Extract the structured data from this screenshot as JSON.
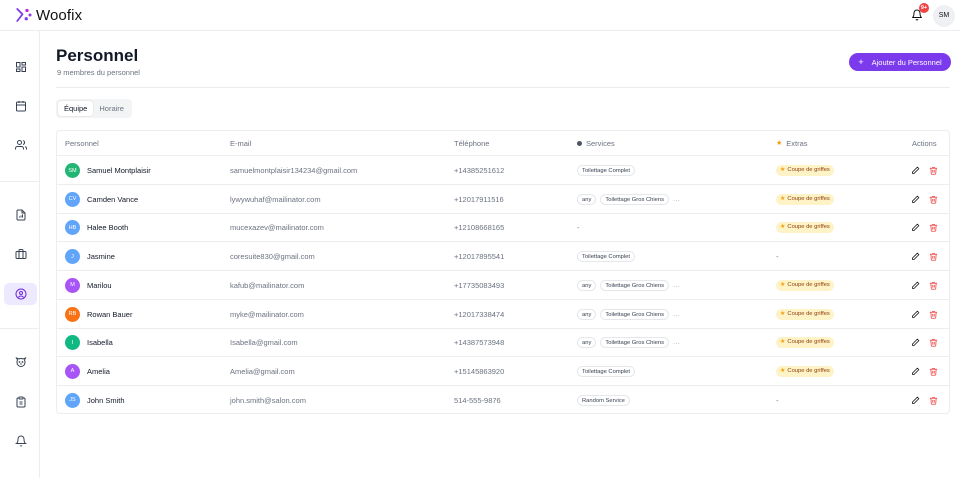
{
  "app": {
    "name": "Woofix"
  },
  "topbar": {
    "notification_count": "9+",
    "user_initials": "SM"
  },
  "sidebar": {
    "items": [
      {
        "name": "dashboard-icon"
      },
      {
        "name": "calendar-icon"
      },
      {
        "name": "users-icon"
      },
      {
        "name": "document-icon"
      },
      {
        "name": "briefcase-icon"
      },
      {
        "name": "user-circle-icon",
        "active": true
      },
      {
        "name": "dog-icon"
      },
      {
        "name": "clipboard-icon"
      },
      {
        "name": "bell-icon"
      }
    ]
  },
  "page": {
    "title": "Personnel",
    "subtitle": "9 membres du personnel",
    "add_button": "Ajouter du Personnel",
    "tabs": [
      {
        "label": "Équipe",
        "active": true
      },
      {
        "label": "Horaire",
        "active": false
      }
    ]
  },
  "table": {
    "headers": {
      "personnel": "Personnel",
      "email": "E-mail",
      "phone": "Téléphone",
      "services": "Services",
      "extras": "Extras",
      "actions": "Actions"
    },
    "rows": [
      {
        "initials": "SM",
        "color": "#22b573",
        "name": "Samuel Montplaisir",
        "email": "samuelmontplaisir134234@gmail.com",
        "phone": "+14385251612",
        "services": [
          "Toilettage Complet"
        ],
        "more": false,
        "extras": "Coupe de griffes"
      },
      {
        "initials": "CV",
        "color": "#60a5fa",
        "name": "Camden Vance",
        "email": "lywywuhaf@mailinator.com",
        "phone": "+12017911516",
        "services": [
          "any",
          "Toilettage Gros Chiens"
        ],
        "more": true,
        "extras": "Coupe de griffes"
      },
      {
        "initials": "HB",
        "color": "#60a5fa",
        "name": "Halee Booth",
        "email": "mucexazev@mailinator.com",
        "phone": "+12108668165",
        "services": [],
        "services_empty": "-",
        "more": false,
        "extras": "Coupe de griffes"
      },
      {
        "initials": "J",
        "color": "#60a5fa",
        "name": "Jasmine",
        "email": "coresuite830@gmail.com",
        "phone": "+12017895541",
        "services": [
          "Toilettage Complet"
        ],
        "more": false,
        "extras": "",
        "extras_empty": "-"
      },
      {
        "initials": "M",
        "color": "#a855f7",
        "name": "Marilou",
        "email": "kafub@mailinator.com",
        "phone": "+17735083493",
        "services": [
          "any",
          "Toilettage Gros Chiens"
        ],
        "more": true,
        "extras": "Coupe de griffes"
      },
      {
        "initials": "RB",
        "color": "#f97316",
        "name": "Rowan Bauer",
        "email": "myke@mailinator.com",
        "phone": "+12017338474",
        "services": [
          "any",
          "Toilettage Gros Chiens"
        ],
        "more": true,
        "extras": "Coupe de griffes"
      },
      {
        "initials": "I",
        "color": "#10b981",
        "name": "Isabella",
        "email": "Isabella@gmail.com",
        "phone": "+14387573948",
        "services": [
          "any",
          "Toilettage Gros Chiens"
        ],
        "more": true,
        "extras": "Coupe de griffes"
      },
      {
        "initials": "A",
        "color": "#a855f7",
        "name": "Amelia",
        "email": "Amelia@gmail.com",
        "phone": "+15145863920",
        "services": [
          "Toilettage Complet"
        ],
        "more": false,
        "extras": "Coupe de griffes"
      },
      {
        "initials": "JS",
        "color": "#60a5fa",
        "name": "John Smith",
        "email": "john.smith@salon.com",
        "phone": "514-555-9876",
        "services": [
          "Random Service"
        ],
        "more": false,
        "extras": "",
        "extras_empty": "-"
      }
    ],
    "more_text": "..."
  },
  "colors": {
    "accent": "#7c3aed",
    "danger": "#ef4444",
    "extras_bg": "#fef3c7"
  }
}
